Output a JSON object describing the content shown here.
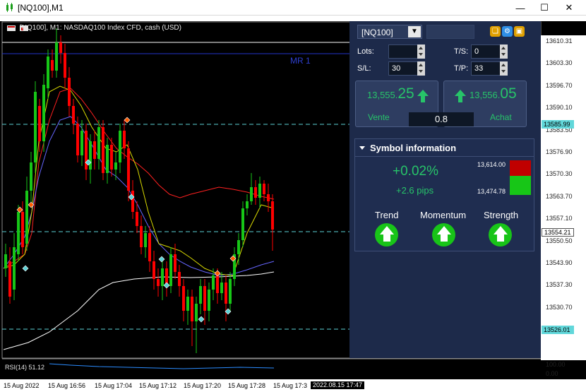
{
  "window": {
    "title": "[NQ100],M1",
    "minimize_glyph": "—",
    "maximize_glyph": "☐",
    "close_glyph": "✕"
  },
  "chart": {
    "header": "[NQ100], M1:  NASDAQ100 Index CFD, cash (USD)",
    "level_label": "MR 1",
    "price_labels": [
      "13610.31",
      "13603.30",
      "13596.70",
      "13590.10",
      "13583.50",
      "13576.90",
      "13570.30",
      "13563.70",
      "13557.10",
      "13550.50",
      "13543.90",
      "13537.30",
      "13530.70",
      "13524.10"
    ],
    "price_tags": {
      "upper": "13585.99",
      "current": "13554.21",
      "lower": "13526.01"
    },
    "rsi": {
      "label": "RSI(14) 51.12",
      "scale_max": "100.00",
      "scale_min": "0.00"
    },
    "time_labels": [
      "15 Aug 2022",
      "15 Aug 16:56",
      "15 Aug 17:04",
      "15 Aug 17:12",
      "15 Aug 17:20",
      "15 Aug 17:28",
      "15 Aug 17:3"
    ],
    "time_cursor": "2022.08.15 17:47",
    "colors": {
      "bull": "#17c617",
      "bear": "#ff0000",
      "background": "#000000",
      "level_line": "#5dd2d6"
    }
  },
  "panel": {
    "symbol": "[NQ100]",
    "lots_label": "Lots:",
    "lots_value": "",
    "ts_label": "T/S:",
    "ts_value": "0",
    "sl_label": "S/L:",
    "sl_value": "30",
    "tp_label": "T/P:",
    "tp_value": "33",
    "sell": {
      "price_small": "13,555.",
      "price_big": "25",
      "label": "Vente"
    },
    "buy": {
      "price_small": "13,556.",
      "price_big": "05",
      "label": "Achat"
    },
    "spread": "0.8",
    "symbol_info": {
      "title": "Symbol information",
      "change_pct": "+0.02%",
      "change_pips": "+2.6 pips",
      "high": "13,614.00",
      "low": "13,474.78",
      "indicators": [
        "Trend",
        "Momentum",
        "Strength"
      ]
    },
    "colors": {
      "panel": "#1d2a4a",
      "positive": "#27c469"
    }
  }
}
